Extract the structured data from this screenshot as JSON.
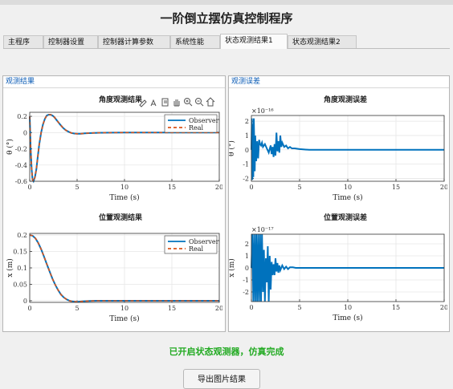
{
  "app": {
    "title": "一阶倒立摆仿真控制程序"
  },
  "tabs": [
    {
      "label": "主程序"
    },
    {
      "label": "控制器设置"
    },
    {
      "label": "控制器计算参数"
    },
    {
      "label": "系统性能"
    },
    {
      "label": "状态观测结果1"
    },
    {
      "label": "状态观测结果2"
    }
  ],
  "active_tab": "状态观测结果1",
  "left_panel": {
    "title": "观测结果"
  },
  "right_panel": {
    "title": "观测误差"
  },
  "toolbar_icons": [
    "brush-icon",
    "data-tip-icon",
    "export-icon",
    "pan-icon",
    "zoom-in-icon",
    "zoom-out-icon",
    "home-icon"
  ],
  "status_text": "已开启状态观测器，仿真完成",
  "export_label": "导出图片结果",
  "colors": {
    "observer": "#0072bd",
    "real": "#d95319",
    "status": "#22aa22",
    "panel_title": "#0a5bb5"
  },
  "chart_data": [
    {
      "type": "line",
      "title": "角度观测结果",
      "xlabel": "Time (s)",
      "ylabel": "θ (°)",
      "xlim": [
        0,
        20
      ],
      "ylim": [
        -0.6,
        0.25
      ],
      "xticks": [
        0,
        5,
        10,
        15,
        20
      ],
      "yticks": [
        -0.6,
        -0.4,
        -0.2,
        0,
        0.2
      ],
      "ytick_labels": [
        "-0.6",
        "-0.4",
        "-0.2",
        "0",
        "0.2"
      ],
      "legend": "top-right",
      "grid": true,
      "series": [
        {
          "name": "Observer",
          "style": "solid",
          "x": [
            0,
            0.1,
            0.2,
            0.3,
            0.4,
            0.55,
            0.7,
            0.85,
            1.0,
            1.2,
            1.4,
            1.6,
            1.8,
            2.0,
            2.2,
            2.4,
            2.6,
            2.8,
            3.0,
            3.2,
            3.5,
            3.8,
            4.1,
            4.4,
            4.7,
            5.0,
            5.4,
            5.8,
            6.2,
            6.8,
            7.5,
            8.5,
            10,
            12,
            15,
            20
          ],
          "y": [
            0.2,
            -0.2,
            -0.45,
            -0.58,
            -0.6,
            -0.55,
            -0.45,
            -0.3,
            -0.15,
            0.0,
            0.1,
            0.17,
            0.21,
            0.22,
            0.22,
            0.21,
            0.19,
            0.16,
            0.13,
            0.1,
            0.06,
            0.03,
            0.01,
            -0.005,
            -0.012,
            -0.015,
            -0.014,
            -0.01,
            -0.007,
            -0.004,
            -0.002,
            -0.001,
            0,
            0,
            0,
            0
          ]
        },
        {
          "name": "Real",
          "style": "dashed",
          "x": [
            0,
            0.1,
            0.2,
            0.3,
            0.4,
            0.55,
            0.7,
            0.85,
            1.0,
            1.2,
            1.4,
            1.6,
            1.8,
            2.0,
            2.2,
            2.4,
            2.6,
            2.8,
            3.0,
            3.2,
            3.5,
            3.8,
            4.1,
            4.4,
            4.7,
            5.0,
            5.4,
            5.8,
            6.2,
            6.8,
            7.5,
            8.5,
            10,
            12,
            15,
            20
          ],
          "y": [
            0.2,
            -0.2,
            -0.45,
            -0.58,
            -0.6,
            -0.55,
            -0.45,
            -0.3,
            -0.15,
            0.0,
            0.1,
            0.17,
            0.21,
            0.22,
            0.22,
            0.21,
            0.19,
            0.16,
            0.13,
            0.1,
            0.06,
            0.03,
            0.01,
            -0.005,
            -0.012,
            -0.015,
            -0.014,
            -0.01,
            -0.007,
            -0.004,
            -0.002,
            -0.001,
            0,
            0,
            0,
            0
          ]
        }
      ]
    },
    {
      "type": "line",
      "title": "位置观测结果",
      "xlabel": "Time (s)",
      "ylabel": "x (m)",
      "xlim": [
        0,
        20
      ],
      "ylim": [
        -0.005,
        0.205
      ],
      "xticks": [
        0,
        5,
        10,
        15,
        20
      ],
      "yticks": [
        0,
        0.05,
        0.1,
        0.15,
        0.2
      ],
      "ytick_labels": [
        "0",
        "0.05",
        "0.1",
        "0.15",
        "0.2"
      ],
      "legend": "top-right",
      "grid": true,
      "series": [
        {
          "name": "Observer",
          "style": "solid",
          "x": [
            0,
            0.3,
            0.6,
            0.9,
            1.2,
            1.5,
            1.8,
            2.1,
            2.4,
            2.7,
            3.0,
            3.3,
            3.6,
            3.9,
            4.2,
            4.5,
            4.8,
            5.1,
            5.5,
            6,
            7,
            8,
            10,
            12,
            15,
            20
          ],
          "y": [
            0.2,
            0.198,
            0.19,
            0.176,
            0.157,
            0.135,
            0.112,
            0.089,
            0.067,
            0.048,
            0.032,
            0.019,
            0.01,
            0.004,
            0.0,
            -0.002,
            -0.003,
            -0.003,
            -0.002,
            -0.001,
            0,
            0,
            0,
            0,
            0,
            0
          ]
        },
        {
          "name": "Real",
          "style": "dashed",
          "x": [
            0,
            0.3,
            0.6,
            0.9,
            1.2,
            1.5,
            1.8,
            2.1,
            2.4,
            2.7,
            3.0,
            3.3,
            3.6,
            3.9,
            4.2,
            4.5,
            4.8,
            5.1,
            5.5,
            6,
            7,
            8,
            10,
            12,
            15,
            20
          ],
          "y": [
            0.2,
            0.198,
            0.19,
            0.176,
            0.157,
            0.135,
            0.112,
            0.089,
            0.067,
            0.048,
            0.032,
            0.019,
            0.01,
            0.004,
            0.0,
            -0.002,
            -0.003,
            -0.003,
            -0.002,
            -0.001,
            0,
            0,
            0,
            0,
            0,
            0
          ]
        }
      ]
    },
    {
      "type": "line",
      "title": "角度观测误差",
      "xlabel": "Time (s)",
      "ylabel": "θ (°)",
      "exponent_label": "×10⁻¹⁶",
      "xlim": [
        0,
        20
      ],
      "ylim": [
        -2.2,
        2.4
      ],
      "xticks": [
        0,
        5,
        10,
        15,
        20
      ],
      "yticks": [
        -2,
        -1,
        0,
        1,
        2
      ],
      "ytick_labels": [
        "-2",
        "-1",
        "0",
        "1",
        "2"
      ],
      "grid": true,
      "series": [
        {
          "name": "",
          "style": "solid",
          "x": [
            0,
            0.05,
            0.1,
            0.15,
            0.2,
            0.25,
            0.3,
            0.35,
            0.4,
            0.5,
            0.6,
            0.7,
            0.8,
            0.9,
            1.0,
            1.1,
            1.2,
            1.4,
            1.6,
            1.8,
            2.0,
            2.1,
            2.2,
            2.3,
            2.4,
            2.5,
            2.6,
            2.7,
            2.8,
            2.9,
            3.0,
            3.1,
            3.2,
            3.4,
            3.6,
            3.8,
            4.0,
            4.2,
            4.5,
            5.0,
            5.5,
            6,
            7,
            20
          ],
          "y": [
            0,
            2.2,
            -2.1,
            1.8,
            -1.9,
            2.2,
            0.5,
            -1.5,
            1.0,
            -0.8,
            0.6,
            -0.6,
            0.7,
            0.4,
            0.3,
            0.5,
            0.2,
            0.4,
            0.1,
            -0.2,
            0.3,
            -0.3,
            0.2,
            -0.5,
            0.4,
            -0.4,
            1.2,
            -0.1,
            0.6,
            -0.2,
            1.0,
            0.2,
            0.5,
            0.2,
            0.3,
            0.1,
            0.2,
            0.1,
            0.1,
            0.05,
            0.02,
            0,
            0,
            0
          ]
        }
      ]
    },
    {
      "type": "line",
      "title": "位置观测误差",
      "xlabel": "Time (s)",
      "ylabel": "x (m)",
      "exponent_label": "×10⁻¹⁷",
      "xlim": [
        0,
        20
      ],
      "ylim": [
        -2.8,
        2.8
      ],
      "xticks": [
        0,
        5,
        10,
        15,
        20
      ],
      "yticks": [
        -2,
        -1,
        0,
        1,
        2
      ],
      "ytick_labels": [
        "-2",
        "-1",
        "0",
        "1",
        "2"
      ],
      "grid": true,
      "series": [
        {
          "name": "",
          "style": "solid",
          "x": [
            0,
            0.1,
            0.2,
            0.3,
            0.4,
            0.5,
            0.6,
            0.7,
            0.8,
            0.9,
            1.0,
            1.1,
            1.2,
            1.3,
            1.4,
            1.5,
            1.6,
            1.7,
            1.8,
            1.9,
            2.0,
            2.1,
            2.2,
            2.3,
            2.4,
            2.5,
            2.6,
            2.7,
            2.8,
            2.9,
            3.0,
            3.2,
            3.4,
            3.6,
            3.8,
            4.0,
            4.3,
            4.6,
            5.0,
            5.5,
            6,
            7,
            20
          ],
          "y": [
            0,
            2.8,
            -2.8,
            2.8,
            -2.8,
            2.8,
            -2.8,
            2.8,
            -2.8,
            2.8,
            -2.8,
            2.8,
            -2.0,
            1.5,
            -2.8,
            0.8,
            -1.2,
            1.8,
            -2.8,
            1.0,
            -1.8,
            0.5,
            -0.6,
            0.3,
            -0.6,
            0.8,
            -0.3,
            0.4,
            -0.4,
            0.2,
            -0.2,
            0.2,
            -0.1,
            0.1,
            -0.1,
            0.05,
            0.05,
            0,
            0,
            0,
            0,
            0,
            0
          ]
        }
      ]
    }
  ]
}
